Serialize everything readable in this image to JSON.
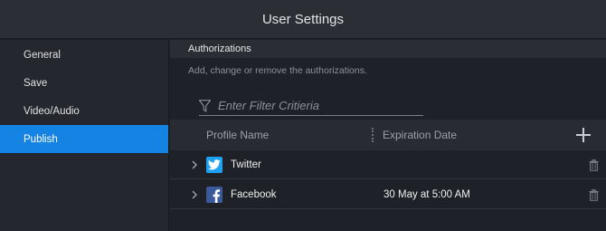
{
  "window": {
    "title": "User Settings"
  },
  "sidebar": {
    "items": [
      {
        "label": "General",
        "active": false
      },
      {
        "label": "Save",
        "active": false
      },
      {
        "label": "Video/Audio",
        "active": false
      },
      {
        "label": "Publish",
        "active": true
      }
    ]
  },
  "main": {
    "section_title": "Authorizations",
    "description": "Add, change or remove the authorizations.",
    "filter": {
      "placeholder": "Enter Filter Critieria",
      "value": ""
    },
    "columns": {
      "profile": "Profile Name",
      "expiration": "Expiration Date"
    },
    "rows": [
      {
        "name": "Twitter",
        "icon": "twitter-icon",
        "expiration": ""
      },
      {
        "name": "Facebook",
        "icon": "facebook-icon",
        "expiration": "30 May at 5:00 AM"
      }
    ]
  },
  "colors": {
    "accent": "#1483e3",
    "twitter": "#1da1f2",
    "facebook": "#3b5998"
  }
}
